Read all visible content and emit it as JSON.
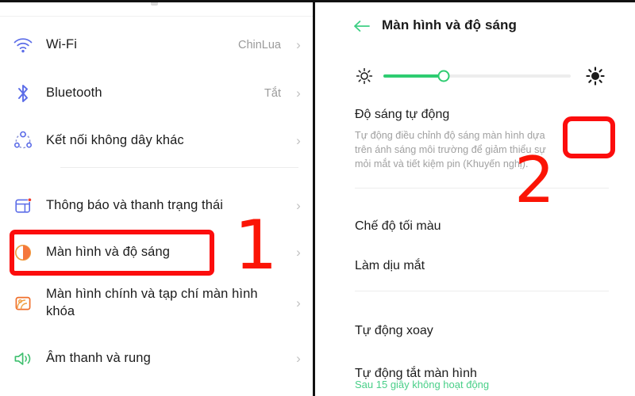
{
  "left_panel": {
    "items": [
      {
        "label": "Wi-Fi",
        "value": "ChinLua",
        "icon": "wifi-icon",
        "chevron": "›"
      },
      {
        "label": "Bluetooth",
        "value": "Tắt",
        "icon": "bluetooth-icon",
        "chevron": "›"
      },
      {
        "label": "Kết nối không dây khác",
        "value": "",
        "icon": "wireless-connections-icon",
        "chevron": "›"
      },
      {
        "label": "Thông báo và thanh trạng thái",
        "value": "",
        "icon": "notification-icon",
        "chevron": "›"
      },
      {
        "label": "Màn hình và độ sáng",
        "value": "",
        "icon": "display-brightness-icon",
        "chevron": "›"
      },
      {
        "label": "Màn hình chính và tạp chí màn hình khóa",
        "value": "",
        "icon": "wallpaper-icon",
        "chevron": "›"
      },
      {
        "label": "Âm thanh và rung",
        "value": "",
        "icon": "sound-vibration-icon",
        "chevron": "›"
      }
    ]
  },
  "right_panel": {
    "title": "Màn hình và độ sáng",
    "back_icon": "back-arrow-icon",
    "brightness": {
      "low_icon": "brightness-low-icon",
      "high_icon": "brightness-high-icon",
      "value_percent": 32
    },
    "auto_brightness": {
      "title": "Độ sáng tự động",
      "description": "Tự động điều chỉnh độ sáng màn hình dựa trên ánh sáng môi trường để giảm thiểu sự mỏi mắt và tiết kiệm pin (Khuyến nghị).",
      "state": "off"
    },
    "rows": [
      {
        "label": "Chế độ tối màu",
        "state": "off"
      },
      {
        "label": "Làm dịu mắt",
        "state": "off"
      },
      {
        "label": "Tự động xoay",
        "state": "on"
      }
    ],
    "screen_timeout": {
      "label": "Tự động tắt màn hình",
      "sublabel": "Sau 15 giây không hoạt động"
    }
  },
  "annotations": {
    "step_one": "1",
    "step_two": "2",
    "highlight_color": "#fc0d0d"
  },
  "colors": {
    "accent_green": "#26d07c",
    "toggle_off": "#e3e3e3",
    "icon_blue": "#5b6ce8",
    "icon_orange": "#f07c2e",
    "icon_green": "#3fbf6f"
  }
}
